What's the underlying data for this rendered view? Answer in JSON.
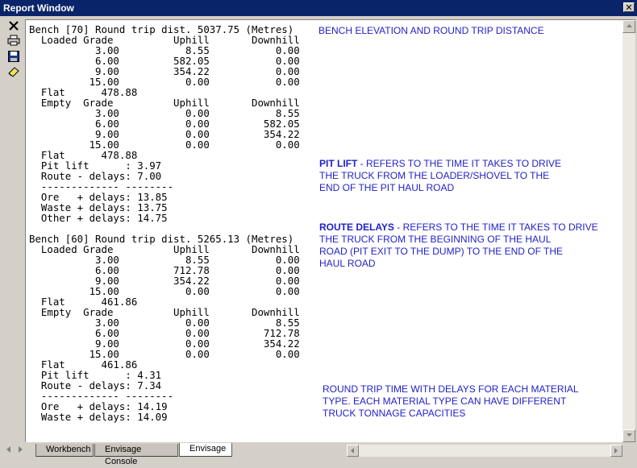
{
  "window": {
    "title": "Report Window",
    "close_glyph": "✕"
  },
  "toolbar": {
    "buttons": [
      {
        "name": "close-report-icon"
      },
      {
        "name": "print-icon"
      },
      {
        "name": "save-icon"
      },
      {
        "name": "eraser-icon"
      }
    ]
  },
  "report": {
    "lines": [
      "Bench [70] Round trip dist. 5037.75 (Metres)",
      "  Loaded Grade          Uphill       Downhill",
      "           3.00           8.55           0.00",
      "           6.00         582.05           0.00",
      "           9.00         354.22           0.00",
      "          15.00           0.00           0.00",
      "  Flat      478.88",
      "  Empty  Grade          Uphill       Downhill",
      "           3.00           0.00           8.55",
      "           6.00           0.00         582.05",
      "           9.00           0.00         354.22",
      "          15.00           0.00           0.00",
      "  Flat      478.88",
      "  Pit lift      : 3.97",
      "  Route - delays: 7.00",
      "  ------------- --------",
      "  Ore   + delays: 13.85",
      "  Waste + delays: 13.75",
      "  Other + delays: 14.75",
      "",
      "Bench [60] Round trip dist. 5265.13 (Metres)",
      "  Loaded Grade          Uphill       Downhill",
      "           3.00           8.55           0.00",
      "           6.00         712.78           0.00",
      "           9.00         354.22           0.00",
      "          15.00           0.00           0.00",
      "  Flat      461.86",
      "  Empty  Grade          Uphill       Downhill",
      "           3.00           0.00           8.55",
      "           6.00           0.00         712.78",
      "           9.00           0.00         354.22",
      "          15.00           0.00           0.00",
      "  Flat      461.86",
      "  Pit lift      : 4.31",
      "  Route - delays: 7.34",
      "  ------------- --------",
      "  Ore   + delays: 14.19",
      "  Waste + delays: 14.09"
    ]
  },
  "annotations": {
    "bench_elevation": "BENCH ELEVATION AND ROUND TRIP DISTANCE",
    "pit_lift_title": "PIT LIFT",
    "pit_lift_text": " - REFERS TO THE TIME IT TAKES TO DRIVE",
    "pit_lift_line2": "THE TRUCK FROM THE LOADER/SHOVEL TO THE",
    "pit_lift_line3": "END OF THE PIT HAUL ROAD",
    "route_delays_title": "ROUTE DELAYS",
    "route_delays_text": " - REFERS TO THE TIME IT TAKES TO DRIVE",
    "route_delays_line2": "THE TRUCK FROM THE BEGINNING OF THE HAUL",
    "route_delays_line3": "ROAD (PIT EXIT TO THE DUMP) TO THE END OF THE",
    "route_delays_line4": "HAUL ROAD",
    "round_trip_line1": "ROUND TRIP TIME WITH DELAYS FOR EACH MATERIAL",
    "round_trip_line2": "TYPE. EACH MATERIAL TYPE CAN HAVE DIFFERENT",
    "round_trip_line3": "TRUCK TONNAGE CAPACITIES"
  },
  "tabs": [
    {
      "label": "Workbench",
      "active": false
    },
    {
      "label": "Envisage Console",
      "active": false
    },
    {
      "label": "Envisage",
      "active": true
    }
  ],
  "colors": {
    "annotation": "#1f1fc8",
    "titlebar": "#0a246a"
  }
}
